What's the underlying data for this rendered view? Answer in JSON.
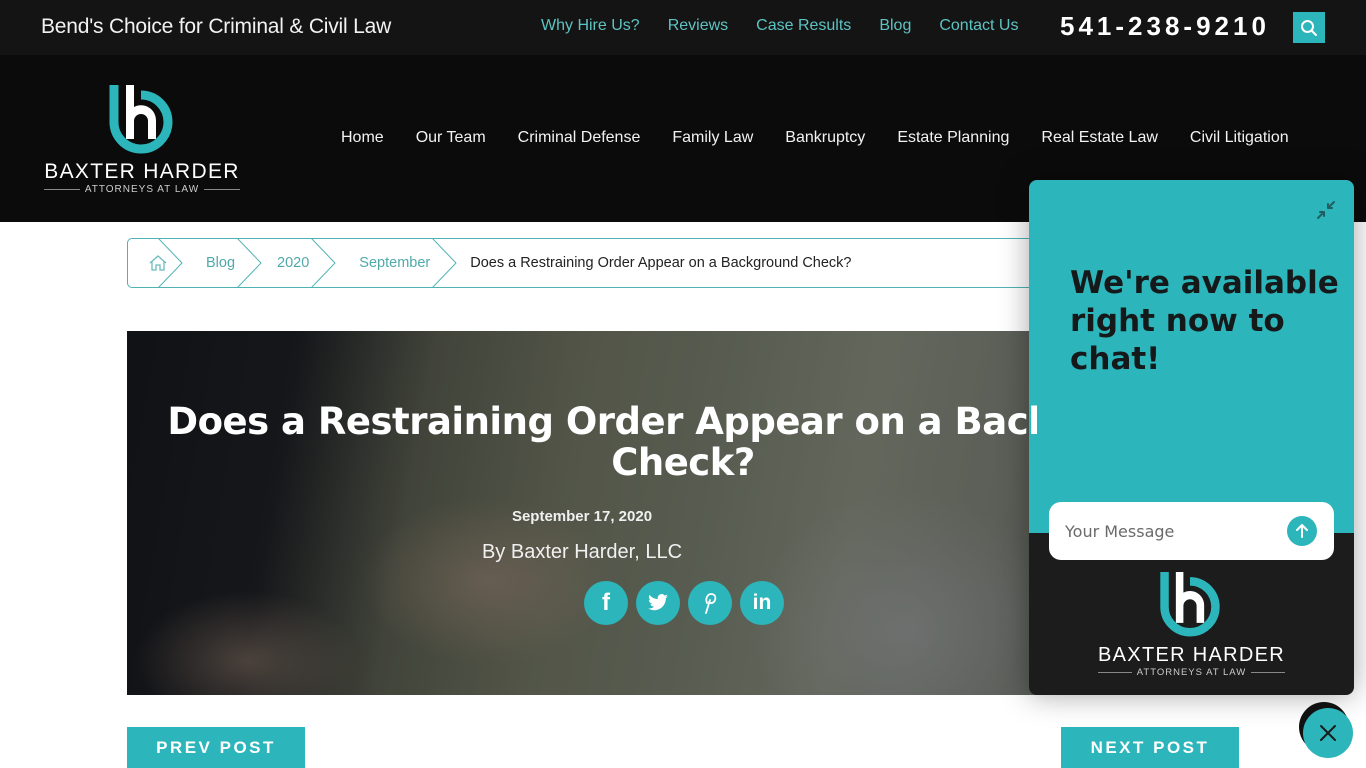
{
  "topbar": {
    "tagline": "Bend's Choice for Criminal & Civil Law",
    "links": [
      {
        "label": "Why Hire Us?"
      },
      {
        "label": "Reviews"
      },
      {
        "label": "Case Results"
      },
      {
        "label": "Blog"
      },
      {
        "label": "Contact Us"
      }
    ],
    "phone": "541-238-9210",
    "search_icon": "search-icon"
  },
  "header": {
    "logo": {
      "brand": "BAXTER HARDER",
      "subtitle": "ATTORNEYS AT LAW"
    },
    "nav": [
      {
        "label": "Home"
      },
      {
        "label": "Our Team"
      },
      {
        "label": "Criminal Defense"
      },
      {
        "label": "Family Law"
      },
      {
        "label": "Bankruptcy"
      },
      {
        "label": "Estate Planning"
      },
      {
        "label": "Real Estate Law"
      },
      {
        "label": "Civil Litigation"
      }
    ]
  },
  "breadcrumb": {
    "home_icon": "home-icon",
    "items": [
      {
        "label": "Blog"
      },
      {
        "label": "2020"
      },
      {
        "label": "September"
      }
    ],
    "current": "Does a Restraining Order Appear on a Background Check?"
  },
  "post": {
    "title": "Does a Restraining Order Appear on a Background Check?",
    "date": "September 17, 2020",
    "author": "By Baxter Harder, LLC",
    "share": [
      {
        "icon": "facebook-icon",
        "glyph": "f"
      },
      {
        "icon": "twitter-icon",
        "glyph": ""
      },
      {
        "icon": "pinterest-icon",
        "glyph": "P"
      },
      {
        "icon": "linkedin-icon",
        "glyph": "in"
      }
    ]
  },
  "post_nav": {
    "prev_label": "PREV POST",
    "next_label": "NEXT POST"
  },
  "chat": {
    "headline": "We're available right now to chat!",
    "input_placeholder": "Your Message",
    "input_value": "",
    "logo": {
      "brand": "BAXTER HARDER",
      "subtitle": "ATTORNEYS AT LAW"
    }
  },
  "colors": {
    "accent": "#2cb5ba",
    "topbar_bg": "#141414",
    "header_bg": "#0b0b0b",
    "link": "#5ec3c3"
  }
}
